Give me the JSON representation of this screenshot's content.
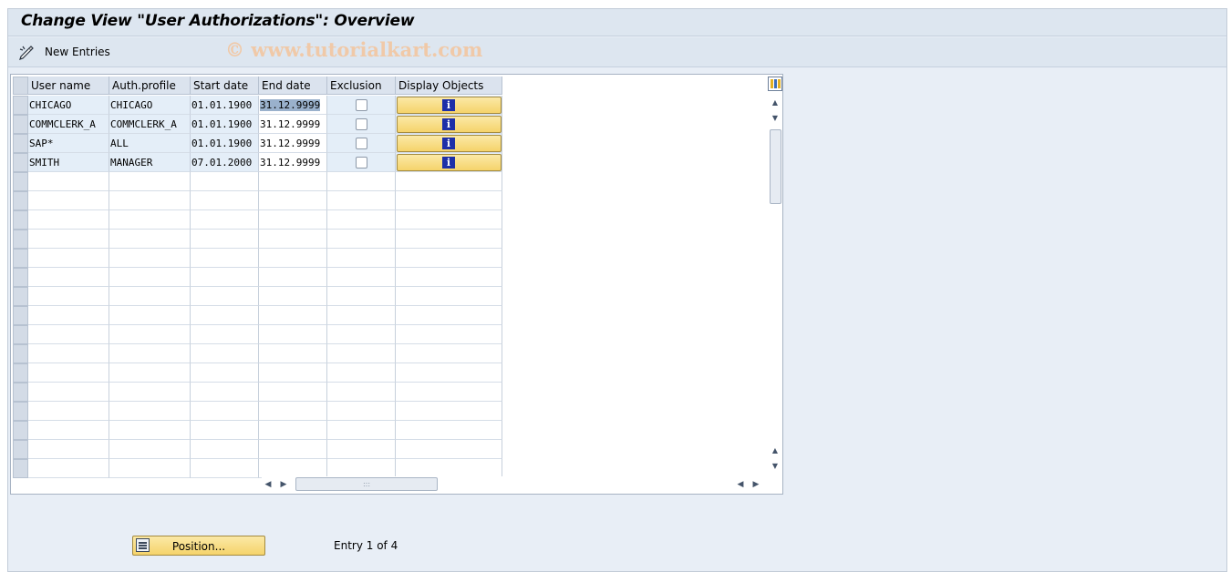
{
  "window": {
    "title": "Change View \"User Authorizations\": Overview"
  },
  "toolbar": {
    "new_entries_label": "New Entries",
    "watermark": "© www.tutorialkart.com"
  },
  "table": {
    "columns": [
      "User name",
      "Auth.profile",
      "Start date",
      "End date",
      "Exclusion",
      "Display Objects"
    ],
    "rows": [
      {
        "user": "CHICAGO",
        "profile": "CHICAGO",
        "start": "01.01.1900",
        "end": "31.12.9999",
        "exclusion": false
      },
      {
        "user": "COMMCLERK_A",
        "profile": "COMMCLERK_A",
        "start": "01.01.1900",
        "end": "31.12.9999",
        "exclusion": false
      },
      {
        "user": "SAP*",
        "profile": "ALL",
        "start": "01.01.1900",
        "end": "31.12.9999",
        "exclusion": false
      },
      {
        "user": "SMITH",
        "profile": "MANAGER",
        "start": "07.01.2000",
        "end": "31.12.9999",
        "exclusion": false
      }
    ],
    "display_icon": "info-icon"
  },
  "footer": {
    "position_label": "Position...",
    "entry_text": "Entry 1 of 4"
  },
  "colors": {
    "title_bar": "#dde6f0",
    "button_yellow": "#f5d36b",
    "info_icon": "#1d2fa8",
    "row_fill": "#e4eef8"
  }
}
